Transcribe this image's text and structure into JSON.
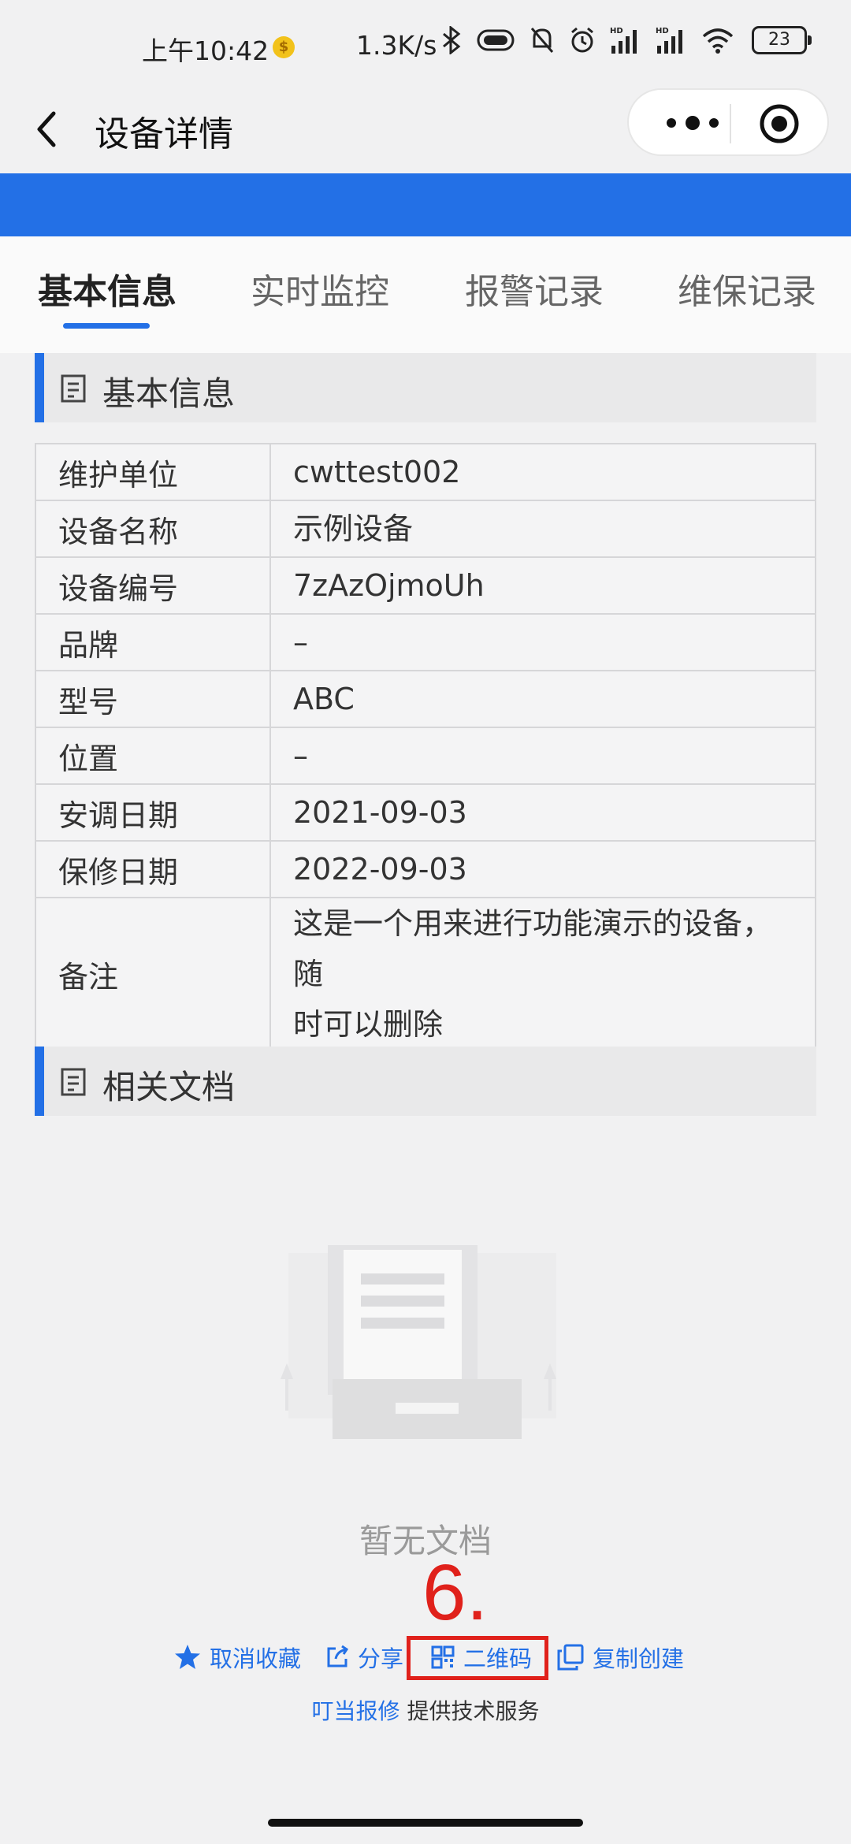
{
  "status_bar": {
    "time": "上午10:42",
    "coin_glyph": "$",
    "net_speed": "1.3K/s",
    "battery": "23",
    "icons": [
      "bluetooth-icon",
      "vibrate-icon",
      "mute-icon",
      "alarm-icon",
      "signal-hd-1-icon",
      "signal-hd-2-icon",
      "wifi-icon",
      "battery-icon"
    ]
  },
  "navbar": {
    "title": "设备详情"
  },
  "tabs": [
    {
      "label": "基本信息",
      "active": true
    },
    {
      "label": "实时监控",
      "active": false
    },
    {
      "label": "报警记录",
      "active": false
    },
    {
      "label": "维保记录",
      "active": false
    }
  ],
  "sections": {
    "basic": "基本信息",
    "docs": "相关文档"
  },
  "info_rows": [
    {
      "key": "维护单位",
      "value": "cwttest002"
    },
    {
      "key": "设备名称",
      "value": "示例设备"
    },
    {
      "key": "设备编号",
      "value": "7zAzOjmoUh"
    },
    {
      "key": "品牌",
      "value": "–"
    },
    {
      "key": "型号",
      "value": "ABC"
    },
    {
      "key": "位置",
      "value": "–"
    },
    {
      "key": "安调日期",
      "value": "2021-09-03"
    },
    {
      "key": "保修日期",
      "value": "2022-09-03"
    },
    {
      "key": "备注",
      "value_line1": "这是一个用来进行功能演示的设备，随",
      "value_line2": "时可以删除"
    }
  ],
  "docs_empty": "暂无文档",
  "annotation": "6.",
  "actions": {
    "unfavorite": "取消收藏",
    "share": "分享",
    "qrcode": "二维码",
    "copy_create": "复制创建"
  },
  "footer": {
    "brand": "叮当报修",
    "service": "提供技术服务"
  },
  "colors": {
    "accent": "#2370e6",
    "annotation": "#e0211b",
    "background": "#f1f1f2"
  }
}
